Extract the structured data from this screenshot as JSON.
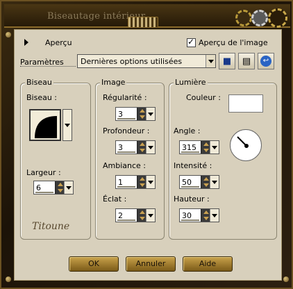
{
  "window": {
    "title": "Biseautage intérieur"
  },
  "header": {
    "apercu_label": "Aperçu",
    "preview_checkbox_label": "Aperçu de l'image",
    "preview_checked": true
  },
  "presets": {
    "label": "Paramètres",
    "selected": "Dernières options utilisées"
  },
  "biseau": {
    "title": "Biseau",
    "biseau_label": "Biseau :",
    "largeur_label": "Largeur :",
    "largeur_value": "6"
  },
  "image": {
    "title": "Image",
    "regularite_label": "Régularité :",
    "regularite_value": "3",
    "profondeur_label": "Profondeur :",
    "profondeur_value": "3",
    "ambiance_label": "Ambiance :",
    "ambiance_value": "1",
    "eclat_label": "Éclat :",
    "eclat_value": "2"
  },
  "lumiere": {
    "title": "Lumière",
    "couleur_label": "Couleur :",
    "couleur_value": "#ffffff",
    "angle_label": "Angle :",
    "angle_value": "315",
    "intensite_label": "Intensité :",
    "intensite_value": "50",
    "hauteur_label": "Hauteur :",
    "hauteur_value": "30"
  },
  "buttons": {
    "ok": "OK",
    "cancel": "Annuler",
    "help": "Aide"
  },
  "icons": {
    "save": "save-icon",
    "delete": "delete-preset-icon",
    "reset": "reset-icon"
  }
}
